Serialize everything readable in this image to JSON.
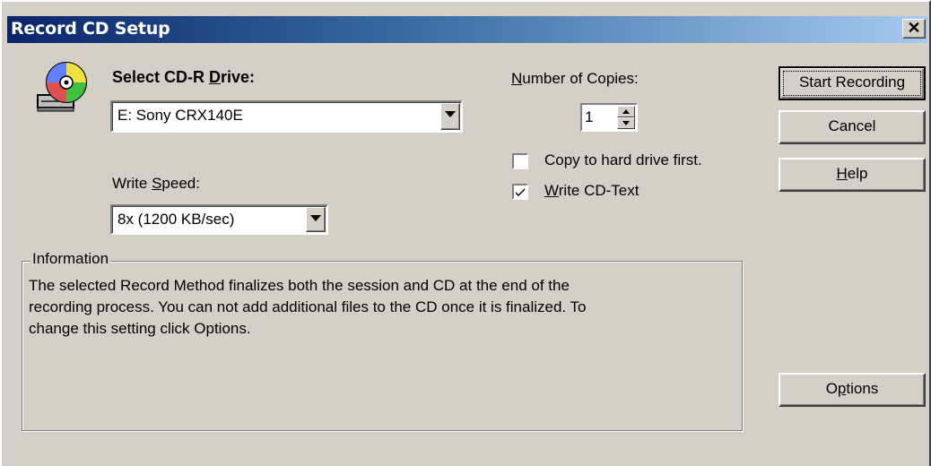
{
  "window": {
    "title": "Record CD Setup",
    "close_glyph": "✕"
  },
  "icon": {
    "name": "cd-drive-icon"
  },
  "drive": {
    "label_pre": "Select CD-R ",
    "label_mnemonic": "D",
    "label_post": "rive:",
    "selected": "E: Sony CRX140E"
  },
  "speed": {
    "label_pre": "Write ",
    "label_mnemonic": "S",
    "label_post": "peed:",
    "selected": "8x (1200 KB/sec)"
  },
  "copies": {
    "label_mnemonic": "N",
    "label_post": "umber of Copies:",
    "value": "1"
  },
  "options": {
    "copy_to_hd": {
      "label": "Copy to hard drive first.",
      "checked": false
    },
    "write_cdtext": {
      "label_mnemonic": "W",
      "label_post": "rite CD-Text",
      "checked": true
    }
  },
  "buttons": {
    "start": "Start Recording",
    "cancel": "Cancel",
    "help_mnemonic": "H",
    "help_post": "elp",
    "options_pre": "O",
    "options_mnemonic": "p",
    "options_post": "tions"
  },
  "information": {
    "legend": "Information",
    "line1": "The selected Record Method finalizes both the session and CD at the end of the",
    "line2": "recording process. You can not add additional files to the CD once it is finalized. To",
    "line3": "change this setting click Options."
  },
  "colors": {
    "face": "#d4d0c8",
    "title_start": "#0a246a",
    "title_end": "#a6caf0"
  }
}
